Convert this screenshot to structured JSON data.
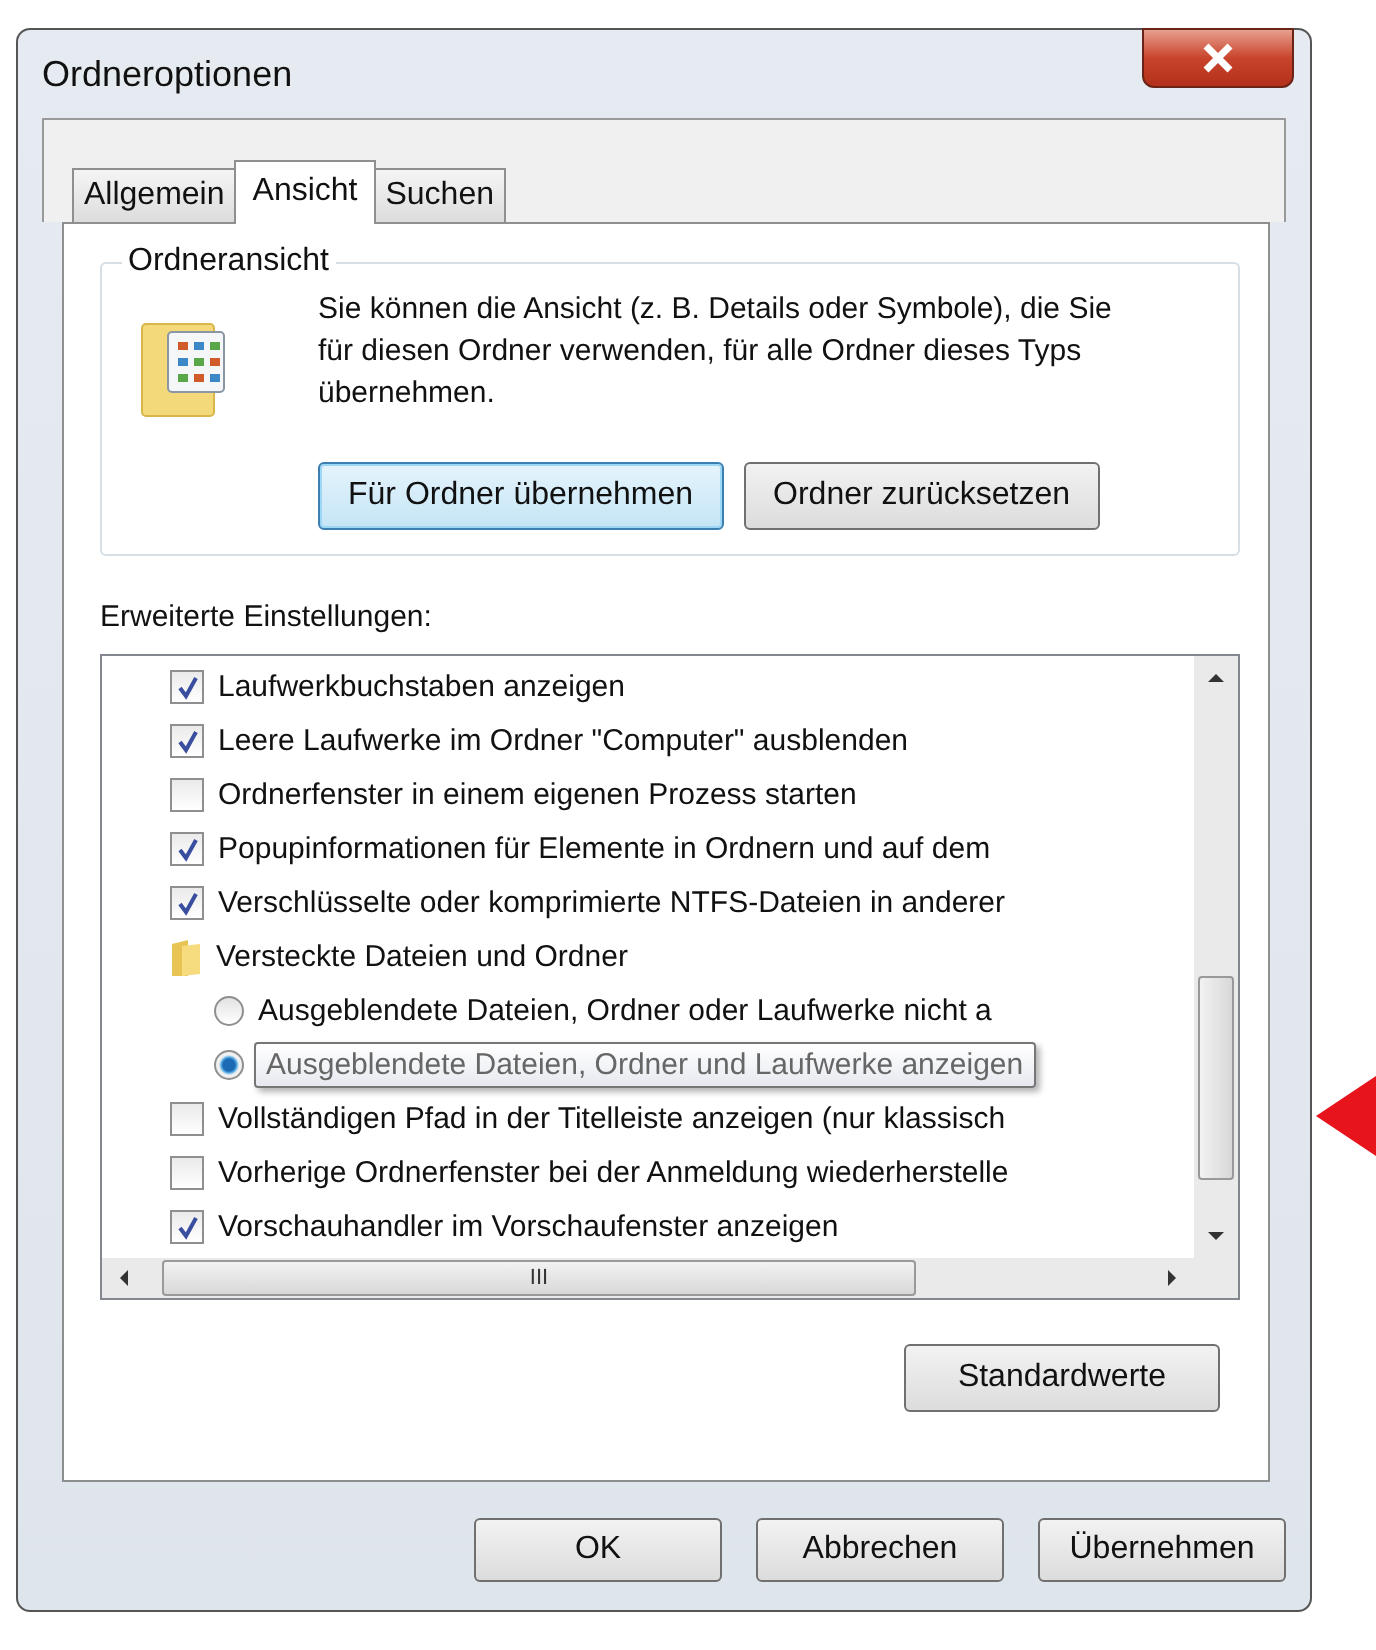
{
  "window": {
    "title": "Ordneroptionen"
  },
  "tabs": [
    {
      "label": "Allgemein",
      "selected": false
    },
    {
      "label": "Ansicht",
      "selected": true
    },
    {
      "label": "Suchen",
      "selected": false
    }
  ],
  "folder_view": {
    "title": "Ordneransicht",
    "description": "Sie können die Ansicht (z. B. Details oder Symbole), die Sie für diesen Ordner verwenden, für alle Ordner dieses Typs übernehmen.",
    "buttons": [
      {
        "label": "Für Ordner übernehmen",
        "focused": true
      },
      {
        "label": "Ordner zurücksetzen",
        "focused": false
      }
    ]
  },
  "advanced": {
    "title": "Erweiterte Einstellungen:",
    "items": [
      {
        "kind": "checkbox",
        "label": "Laufwerkbuchstaben anzeigen",
        "checked": true
      },
      {
        "kind": "checkbox",
        "label": "Leere Laufwerke im Ordner \"Computer\" ausblenden",
        "checked": true
      },
      {
        "kind": "checkbox",
        "label": "Ordnerfenster in einem eigenen Prozess starten",
        "checked": false
      },
      {
        "kind": "checkbox",
        "label": "Popupinformationen für Elemente in Ordnern und auf dem",
        "checked": true
      },
      {
        "kind": "checkbox",
        "label": "Verschlüsselte oder komprimierte NTFS-Dateien in anderer",
        "checked": true
      },
      {
        "kind": "folder",
        "label": "Versteckte Dateien und Ordner",
        "children": [
          {
            "kind": "radio",
            "label": "Ausgeblendete Dateien, Ordner oder Laufwerke nicht a",
            "selected": false,
            "tooltip": false
          },
          {
            "kind": "radio",
            "label": "Ausgeblendete Dateien, Ordner und Laufwerke anzeigen",
            "selected": true,
            "tooltip": true
          }
        ]
      },
      {
        "kind": "checkbox",
        "label": "Vollständigen Pfad in der Titelleiste anzeigen (nur klassisch",
        "checked": false
      },
      {
        "kind": "checkbox",
        "label": "Vorherige Ordnerfenster bei der Anmeldung wiederherstelle",
        "checked": false
      },
      {
        "kind": "checkbox",
        "label": "Vorschauhandler im Vorschaufenster anzeigen",
        "checked": true
      }
    ],
    "hscroll_label": "III",
    "restore_button": "Standardwerte"
  },
  "buttons": [
    "OK",
    "Abbrechen",
    "Übernehmen"
  ]
}
